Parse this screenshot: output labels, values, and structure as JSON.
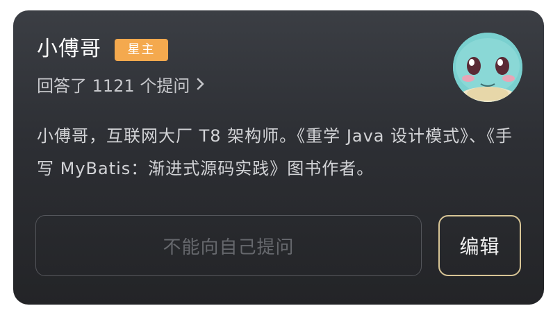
{
  "profile": {
    "name": "小傅哥",
    "badge": "星主",
    "answers_text": "回答了 1121 个提问",
    "bio": "小傅哥，互联网大厂 T8 架构师。《重学 Java 设计模式》、《手写 MyBatis：渐进式源码实践》图书作者。"
  },
  "actions": {
    "ask_placeholder": "不能向自己提问",
    "edit_label": "编辑"
  },
  "colors": {
    "badge": "#f4a94e",
    "edit_border": "#d8c596",
    "card_top": "#3b3e44",
    "card_bottom": "#232427"
  },
  "icons": {
    "answers_arrow": "chevron-right-icon",
    "avatar": "avatar"
  }
}
